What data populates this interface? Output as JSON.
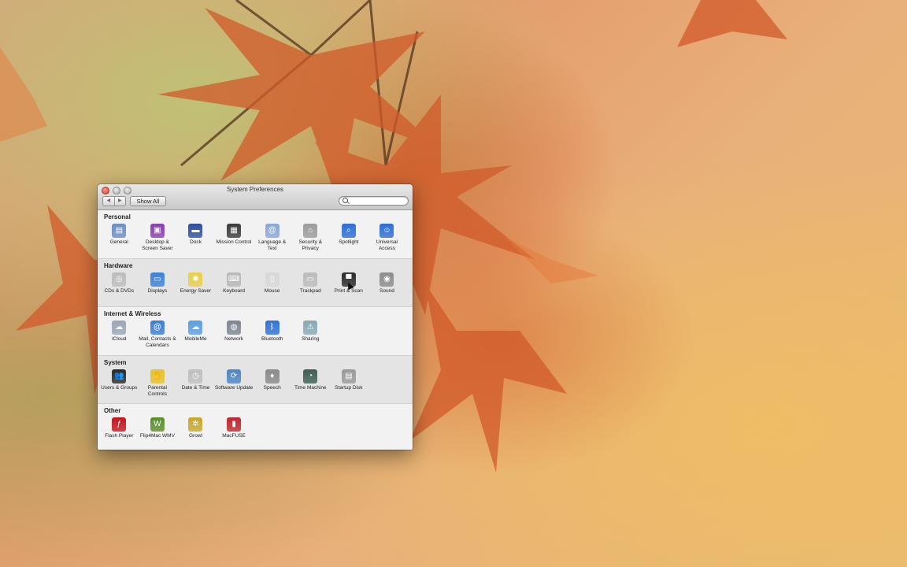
{
  "window": {
    "title": "System Preferences",
    "nav_back": "◀",
    "nav_forward": "▶",
    "show_all_label": "Show All",
    "search_placeholder": ""
  },
  "sections": [
    {
      "label": "Personal",
      "items": [
        {
          "label": "General",
          "icon": "general-icon",
          "glyph": "▤",
          "color": "#6b8fc4"
        },
        {
          "label": "Desktop & Screen Saver",
          "icon": "desktop-screensaver-icon",
          "glyph": "▣",
          "color": "#8a3fb0"
        },
        {
          "label": "Dock",
          "icon": "dock-icon",
          "glyph": "▬",
          "color": "#2c4f9e"
        },
        {
          "label": "Mission Control",
          "icon": "mission-control-icon",
          "glyph": "▦",
          "color": "#3b3b3b"
        },
        {
          "label": "Language & Text",
          "icon": "language-text-icon",
          "glyph": "@",
          "color": "#8aa7d8"
        },
        {
          "label": "Security & Privacy",
          "icon": "security-privacy-icon",
          "glyph": "⌂",
          "color": "#9c9c9c"
        },
        {
          "label": "Spotlight",
          "icon": "spotlight-icon",
          "glyph": "⌕",
          "color": "#2d6fd6"
        },
        {
          "label": "Universal Access",
          "icon": "universal-access-icon",
          "glyph": "☺",
          "color": "#2e6fd4"
        }
      ]
    },
    {
      "label": "Hardware",
      "items": [
        {
          "label": "CDs & DVDs",
          "icon": "cds-dvds-icon",
          "glyph": "◎",
          "color": "#bdbdbd"
        },
        {
          "label": "Displays",
          "icon": "displays-icon",
          "glyph": "▭",
          "color": "#3b82d8"
        },
        {
          "label": "Energy Saver",
          "icon": "energy-saver-icon",
          "glyph": "✺",
          "color": "#e8d04a"
        },
        {
          "label": "Keyboard",
          "icon": "keyboard-icon",
          "glyph": "⌨",
          "color": "#b7b7b7"
        },
        {
          "label": "Mouse",
          "icon": "mouse-icon",
          "glyph": "▯",
          "color": "#d8d8d8"
        },
        {
          "label": "Trackpad",
          "icon": "trackpad-icon",
          "glyph": "▭",
          "color": "#bcbcbc"
        },
        {
          "label": "Print & Scan",
          "icon": "print-scan-icon",
          "glyph": "▀",
          "color": "#2b2b2b"
        },
        {
          "label": "Sound",
          "icon": "sound-icon",
          "glyph": "◉",
          "color": "#8d8d8d"
        }
      ]
    },
    {
      "label": "Internet & Wireless",
      "items": [
        {
          "label": "iCloud",
          "icon": "icloud-icon",
          "glyph": "☁",
          "color": "#9aa7b8"
        },
        {
          "label": "Mail, Contacts & Calendars",
          "icon": "mail-contacts-calendars-icon",
          "glyph": "@",
          "color": "#3d7dd6"
        },
        {
          "label": "MobileMe",
          "icon": "mobileme-icon",
          "glyph": "☁",
          "color": "#5c9ee0"
        },
        {
          "label": "Network",
          "icon": "network-icon",
          "glyph": "◍",
          "color": "#7d8791"
        },
        {
          "label": "Bluetooth",
          "icon": "bluetooth-icon",
          "glyph": "ᛒ",
          "color": "#2f73d8"
        },
        {
          "label": "Sharing",
          "icon": "sharing-icon",
          "glyph": "⚠",
          "color": "#88a9b5"
        }
      ]
    },
    {
      "label": "System",
      "items": [
        {
          "label": "Users & Groups",
          "icon": "users-groups-icon",
          "glyph": "👥",
          "color": "#2a2a2a"
        },
        {
          "label": "Parental Controls",
          "icon": "parental-controls-icon",
          "glyph": "✋",
          "color": "#e6c230"
        },
        {
          "label": "Date & Time",
          "icon": "date-time-icon",
          "glyph": "◷",
          "color": "#bfbfbf"
        },
        {
          "label": "Software Update",
          "icon": "software-update-icon",
          "glyph": "⟳",
          "color": "#4d86c7"
        },
        {
          "label": "Speech",
          "icon": "speech-icon",
          "glyph": "♦",
          "color": "#8a8a8a"
        },
        {
          "label": "Time Machine",
          "icon": "time-machine-icon",
          "glyph": "◔",
          "color": "#3f5f55"
        },
        {
          "label": "Startup Disk",
          "icon": "startup-disk-icon",
          "glyph": "▤",
          "color": "#9a9a9a"
        }
      ]
    },
    {
      "label": "Other",
      "items": [
        {
          "label": "Flash Player",
          "icon": "flash-player-icon",
          "glyph": "ƒ",
          "color": "#c4161c"
        },
        {
          "label": "Flip4Mac WMV",
          "icon": "flip4mac-wmv-icon",
          "glyph": "W",
          "color": "#5a8f2b"
        },
        {
          "label": "Growl",
          "icon": "growl-icon",
          "glyph": "✲",
          "color": "#c9a72c"
        },
        {
          "label": "MacFUSE",
          "icon": "macfuse-icon",
          "glyph": "▮",
          "color": "#c0272d"
        }
      ]
    }
  ]
}
